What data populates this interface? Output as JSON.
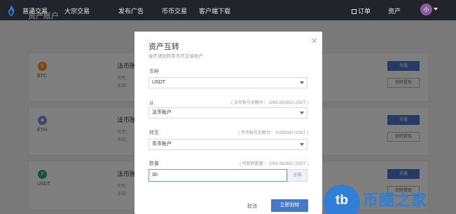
{
  "nav": {
    "items": [
      "普通交易",
      "大宗交易",
      "发布广告",
      "币币交易",
      "客户端下载"
    ],
    "orders": "订单",
    "assets": "资产",
    "avatar": "小"
  },
  "background": {
    "page_title": "资产账户",
    "cards": [
      {
        "coin": "BTC",
        "icon": "฿",
        "icon_color": "#f7931a",
        "title": "法币账",
        "line1": "可用：",
        "line2": "冻结：",
        "btn_a": "充值",
        "btn_b": "划转提现"
      },
      {
        "coin": "ETH",
        "icon": "◆",
        "icon_color": "#7b8ad8",
        "title": "法币账",
        "line1": "可用：",
        "line2": "冻结：",
        "btn_a": "充值",
        "btn_b": "划转提现"
      },
      {
        "coin": "USDT",
        "icon": "₮",
        "icon_color": "#26a17b",
        "title": "法币账",
        "line1": "可用：",
        "line2": "冻结：",
        "btn_a": "充值",
        "btn_b": "划转提现"
      }
    ]
  },
  "modal": {
    "title": "资产互转",
    "subtitle": "接币请划转至币币交易账户",
    "currency_label": "币种",
    "currency_value": "USDT",
    "from_label": "从",
    "from_hint": "( 法币账号余额为： 1063.982662 USDT )",
    "from_value": "法币账户",
    "to_label": "转至",
    "to_hint": "( 币币账号余额为： 0.000000 USDT )",
    "to_value": "币币账户",
    "amount_label": "数量",
    "amount_hint": "( 可划转数量： 1063.982662 USDT )",
    "amount_value": "30",
    "all_label": "全部",
    "cancel_label": "取消",
    "confirm_label": "立即划转"
  },
  "watermark": {
    "logo_text": "tb",
    "brand_text": "币圈之家"
  }
}
